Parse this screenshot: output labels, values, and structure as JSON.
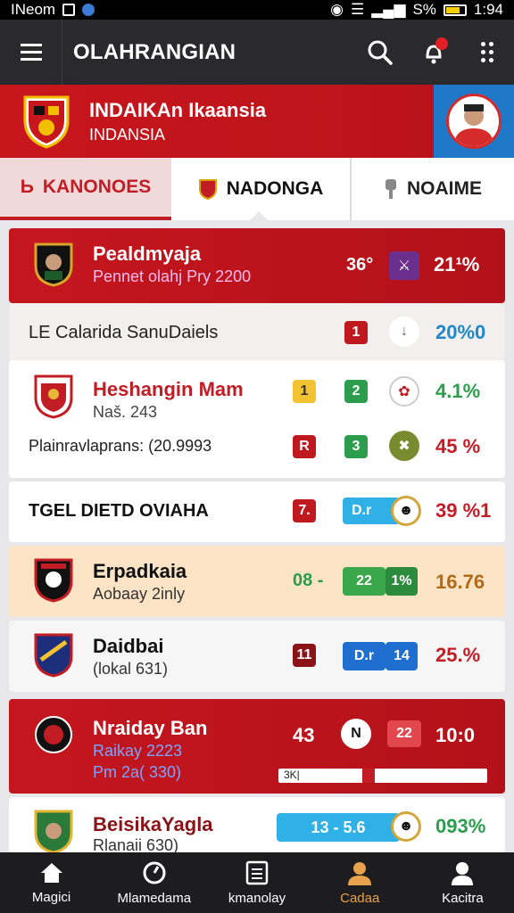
{
  "status_bar": {
    "carrier": "INeom",
    "battery": "S%",
    "time": "1:94"
  },
  "app_bar": {
    "title": "OLAHRANGIAN"
  },
  "banner": {
    "title": "INDAIKAn Ikaansia",
    "subtitle": "INDANSIA"
  },
  "tabs": [
    {
      "label": "KANONOES"
    },
    {
      "label": "NADONGA"
    },
    {
      "label": "NOAIME"
    }
  ],
  "rows": [
    {
      "name": "Pealdmyaja",
      "sub": "Pennet olahj Pry 2200",
      "v1": "36°",
      "v2": "21¹%"
    },
    {
      "title": "LE Calarida SanuDaiels",
      "b1": "1",
      "pct": "20%0"
    },
    {
      "name": "Heshangin Mam",
      "sub": "Naš. 243",
      "b1": "1",
      "b2": "2",
      "pct": "4.1%"
    },
    {
      "title": "Plainravlaprans: (20.9993",
      "b1": "R",
      "b2": "3",
      "pct": "45 %"
    },
    {
      "title": "TGEL DIETD OVIAHA",
      "b1": "7.",
      "mid": "D.r",
      "pct": "39 %1"
    },
    {
      "name": "Erpadkaia",
      "sub": "Aobaay 2inly",
      "score": "08 -",
      "b1": "22",
      "b2": "1%",
      "pct": "16.76"
    },
    {
      "name": "Daidbai",
      "sub": "(lokal 631)",
      "b1": "11",
      "mid": "D.r",
      "b2": "14",
      "pct": "25.%"
    },
    {
      "name": "Nraiday Ban",
      "sub": "Raikay 2223",
      "sub2": "Pm 2a( 330)",
      "v1": "43",
      "b1": "22",
      "pct": "10:0",
      "bar_label": "3K|"
    },
    {
      "name": "BeisikaYagla",
      "sub": "Rlanaii 630)",
      "score": "13 - 5.6",
      "pct": "093%"
    }
  ],
  "bottom_nav": [
    {
      "label": "Magici"
    },
    {
      "label": "Mlamedama"
    },
    {
      "label": "kmanolay"
    },
    {
      "label": "Cadaa"
    },
    {
      "label": "Kacitra"
    }
  ],
  "colors": {
    "brand_red": "#c5161e",
    "green": "#2c9d4c",
    "blue": "#1e88c9",
    "orange": "#e8a24c"
  }
}
